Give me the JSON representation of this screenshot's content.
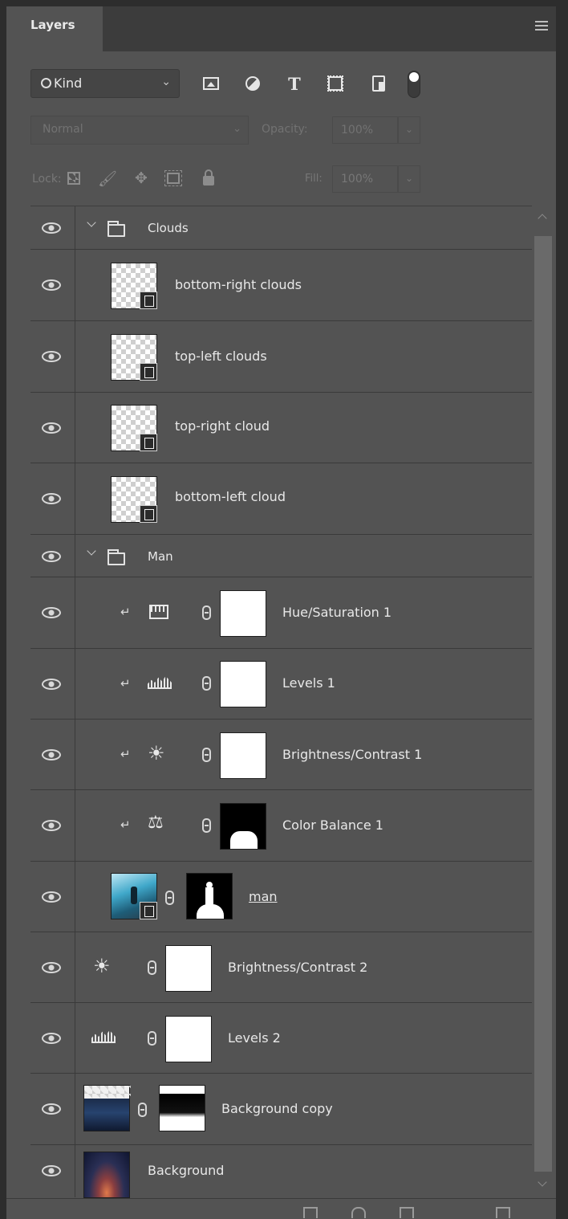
{
  "panel": {
    "tab_label": "Layers",
    "menu_icon": "hamburger-icon"
  },
  "filter": {
    "kind_label": "Kind",
    "filter_icons": [
      "pixel-layer-filter-icon",
      "adjustment-layer-filter-icon",
      "type-layer-filter-icon",
      "shape-layer-filter-icon",
      "smart-object-filter-icon"
    ],
    "type_glyph": "T",
    "filter_toggle_on": true
  },
  "blend": {
    "mode": "Normal",
    "opacity_label": "Opacity:",
    "opacity_value": "100%"
  },
  "lock": {
    "label": "Lock:",
    "fill_label": "Fill:",
    "fill_value": "100%"
  },
  "layers": [
    {
      "name": "Clouds",
      "type": "group",
      "expanded": true
    },
    {
      "name": "bottom-right clouds",
      "type": "smart-object"
    },
    {
      "name": "top-left clouds",
      "type": "smart-object"
    },
    {
      "name": "top-right cloud",
      "type": "smart-object"
    },
    {
      "name": "bottom-left cloud",
      "type": "smart-object"
    },
    {
      "name": "Man",
      "type": "group",
      "expanded": true
    },
    {
      "name": "Hue/Saturation 1",
      "type": "adjustment",
      "icon": "hue-saturation-icon",
      "clipped": true,
      "mask": "white"
    },
    {
      "name": "Levels 1",
      "type": "adjustment",
      "icon": "levels-icon",
      "clipped": true,
      "mask": "white"
    },
    {
      "name": "Brightness/Contrast 1",
      "type": "adjustment",
      "icon": "brightness-contrast-icon",
      "clipped": true,
      "mask": "white"
    },
    {
      "name": "Color Balance 1",
      "type": "adjustment",
      "icon": "color-balance-icon",
      "clipped": true,
      "mask": "black"
    },
    {
      "name": "man",
      "type": "smart-object-masked"
    },
    {
      "name": "Brightness/Contrast 2",
      "type": "adjustment",
      "icon": "brightness-contrast-icon",
      "mask": "white"
    },
    {
      "name": "Levels 2",
      "type": "adjustment",
      "icon": "levels-icon",
      "mask": "white"
    },
    {
      "name": "Background copy",
      "type": "pixel-masked"
    },
    {
      "name": "Background",
      "type": "pixel"
    }
  ]
}
